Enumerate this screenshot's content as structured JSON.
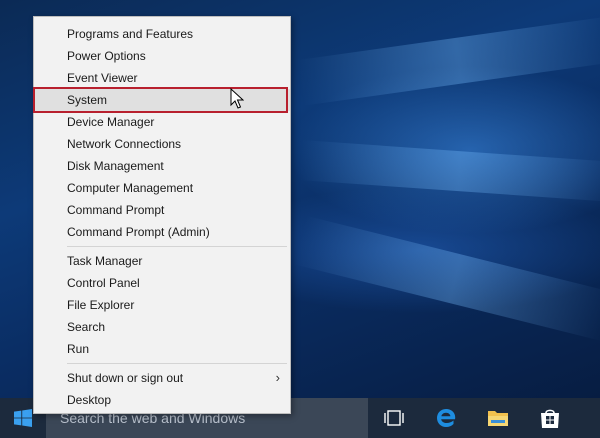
{
  "menu": {
    "groups": [
      [
        {
          "label": "Programs and Features"
        },
        {
          "label": "Power Options"
        },
        {
          "label": "Event Viewer"
        },
        {
          "label": "System",
          "hovered": true
        },
        {
          "label": "Device Manager"
        },
        {
          "label": "Network Connections"
        },
        {
          "label": "Disk Management"
        },
        {
          "label": "Computer Management"
        },
        {
          "label": "Command Prompt"
        },
        {
          "label": "Command Prompt (Admin)"
        }
      ],
      [
        {
          "label": "Task Manager"
        },
        {
          "label": "Control Panel"
        },
        {
          "label": "File Explorer"
        },
        {
          "label": "Search"
        },
        {
          "label": "Run"
        }
      ],
      [
        {
          "label": "Shut down or sign out",
          "submenu": true
        },
        {
          "label": "Desktop"
        }
      ]
    ],
    "submenu_glyph": "›",
    "highlight_color": "#b8202e"
  },
  "taskbar": {
    "search_placeholder": "Search the web and Windows",
    "icons": [
      "windows-logo-icon",
      "task-view-icon",
      "edge-icon",
      "file-explorer-icon",
      "store-icon"
    ],
    "background": "#1c2a3d"
  }
}
